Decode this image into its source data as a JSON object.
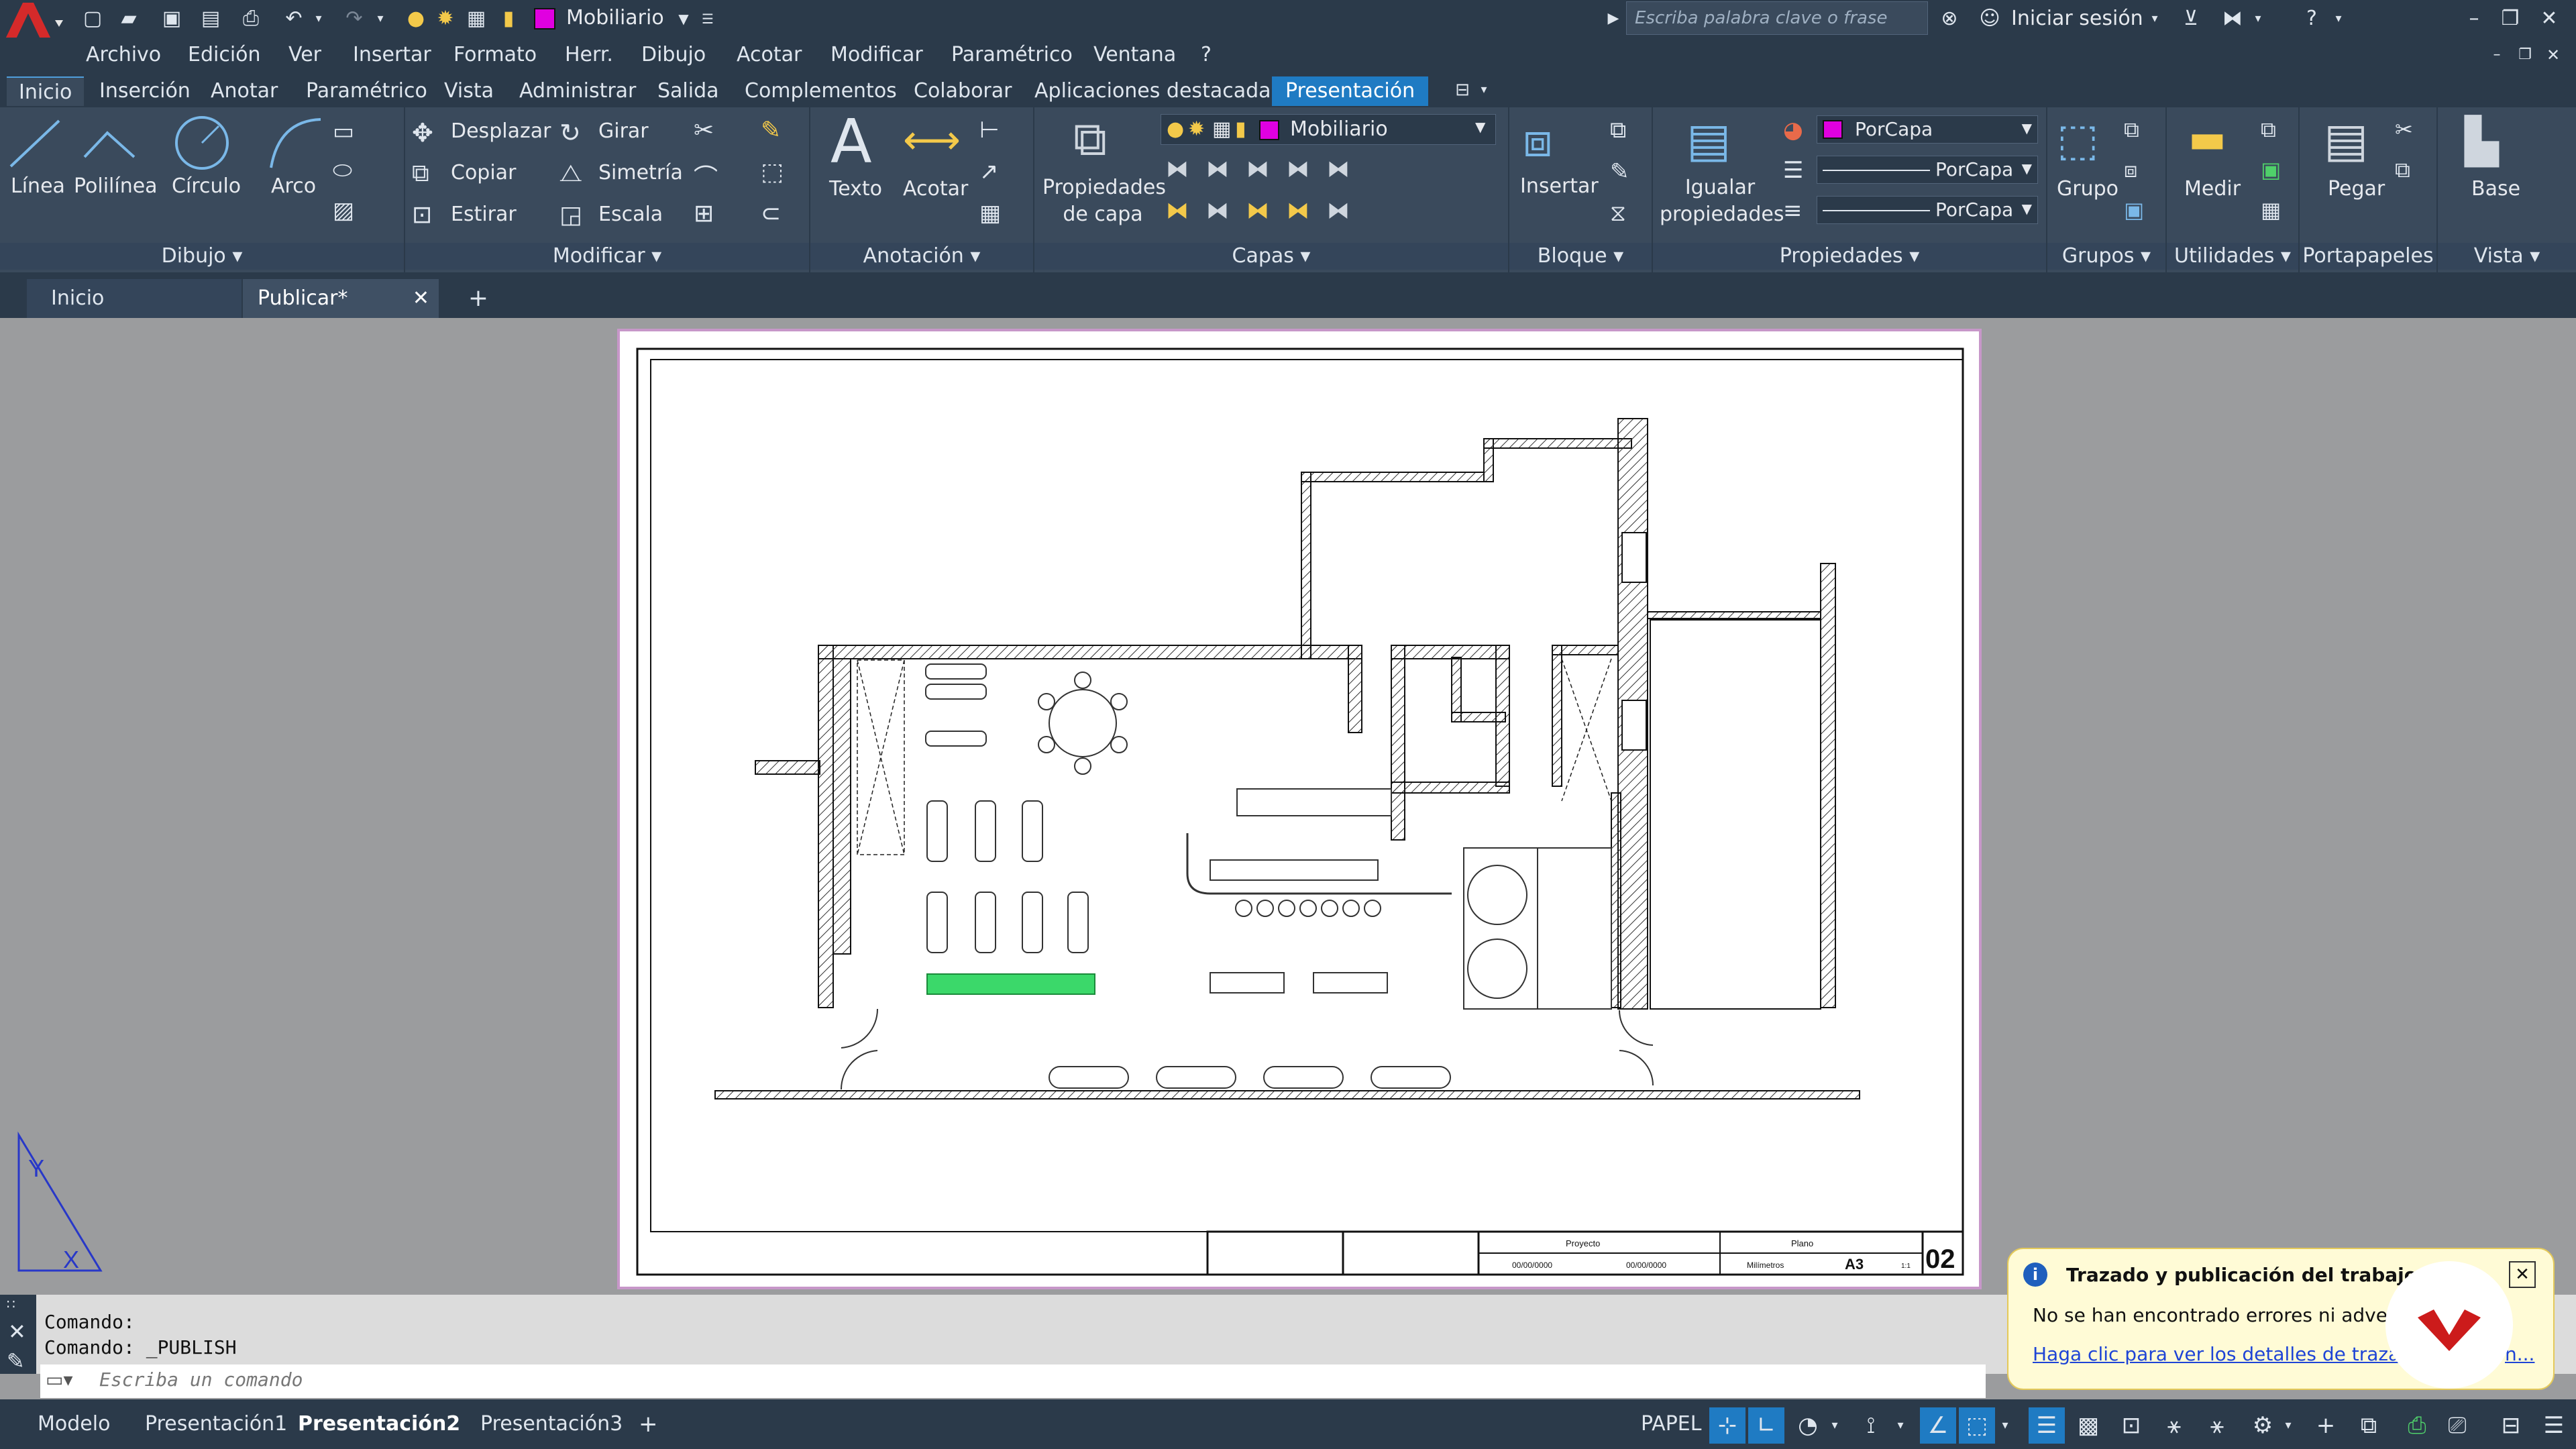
{
  "quick_access": {
    "layer_name": "Mobiliario",
    "layer_color": "#e000e0"
  },
  "search": {
    "placeholder": "Escriba palabra clave o frase"
  },
  "account": {
    "signin": "Iniciar sesión"
  },
  "menu": [
    "Archivo",
    "Edición",
    "Ver",
    "Insertar",
    "Formato",
    "Herr.",
    "Dibujo",
    "Acotar",
    "Modificar",
    "Paramétrico",
    "Ventana",
    "?"
  ],
  "ribbon_tabs": [
    "Inicio",
    "Inserción",
    "Anotar",
    "Paramétrico",
    "Vista",
    "Administrar",
    "Salida",
    "Complementos",
    "Colaborar",
    "Aplicaciones destacadas",
    "Presentación"
  ],
  "panels": {
    "dibujo": {
      "title": "Dibujo",
      "tools": [
        "Línea",
        "Polilínea",
        "Círculo",
        "Arco"
      ]
    },
    "modificar": {
      "title": "Modificar",
      "tools": [
        "Desplazar",
        "Girar",
        "Copiar",
        "Simetría",
        "Estirar",
        "Escala"
      ]
    },
    "anotacion": {
      "title": "Anotación",
      "tools": [
        "Texto",
        "Acotar"
      ]
    },
    "capas": {
      "title": "Capas",
      "tool": "Propiedades de capa",
      "layer": "Mobiliario"
    },
    "bloque": {
      "title": "Bloque",
      "tool": "Insertar"
    },
    "propiedades": {
      "title": "Propiedades",
      "tool": "Igualar propiedades",
      "color": "PorCapa",
      "linetype": "PorCapa",
      "lineweight": "PorCapa"
    },
    "grupos": {
      "title": "Grupos",
      "tool": "Grupo"
    },
    "utilidades": {
      "title": "Utilidades",
      "tool": "Medir"
    },
    "portapapeles": {
      "title": "Portapapeles",
      "tool": "Pegar"
    },
    "vista": {
      "title": "Vista",
      "tool": "Base"
    }
  },
  "doc_tabs": [
    "Inicio",
    "Publicar*"
  ],
  "titleblock": {
    "proyecto": "Proyecto",
    "plano": "Plano",
    "date1": "00/00/0000",
    "date2": "00/00/0000",
    "units": "Milímetros",
    "size": "A3",
    "scale": "1:1",
    "number": "02"
  },
  "command": {
    "line1": "Comando:",
    "line2": "Comando: _PUBLISH",
    "placeholder": "Escriba un comando"
  },
  "layout_tabs": [
    "Modelo",
    "Presentación1",
    "Presentación2",
    "Presentación3"
  ],
  "status": {
    "space": "PAPEL"
  },
  "balloon": {
    "title": "Trazado y publicación del trabajo co",
    "message": "No se han encontrado errores ni adverte",
    "link": "Haga clic para ver los detalles de trazado",
    "link_tail": "n..."
  }
}
